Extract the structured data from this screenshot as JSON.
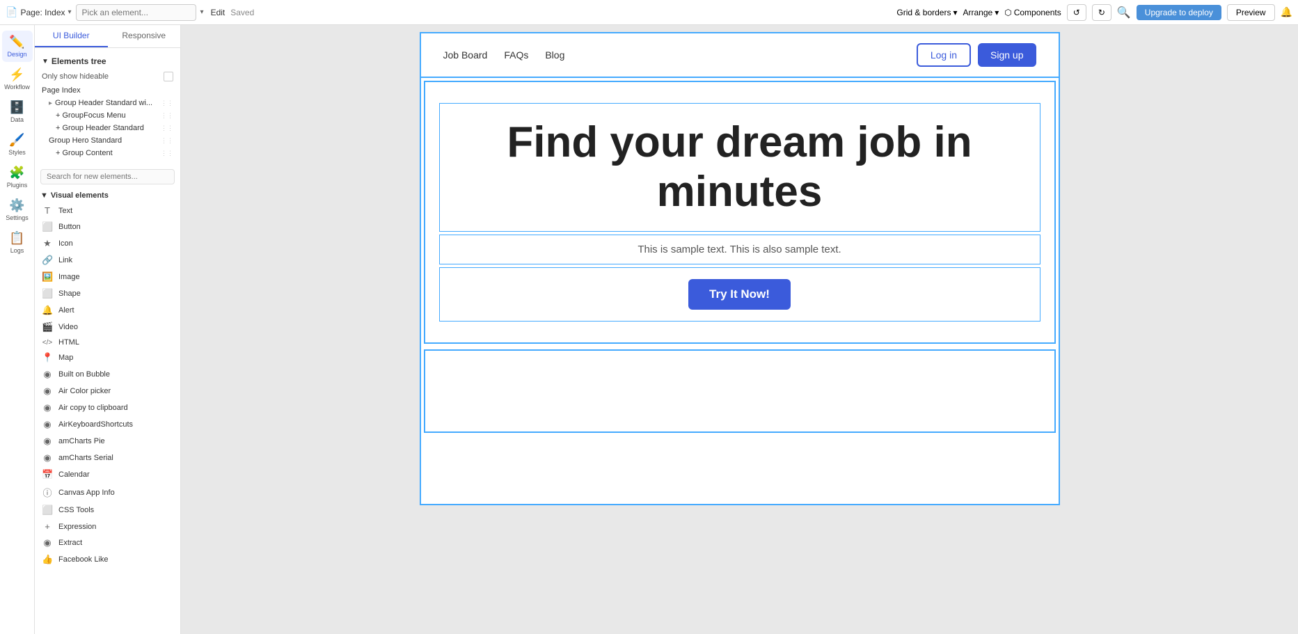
{
  "topbar": {
    "page_icon": "📄",
    "page_label": "Page: Index",
    "pick_placeholder": "Pick an element...",
    "edit_label": "Edit",
    "saved_label": "Saved",
    "grid_borders": "Grid & borders",
    "arrange": "Arrange",
    "components": "Components",
    "upgrade_label": "Upgrade to deploy",
    "preview_label": "Preview"
  },
  "left_sidebar": {
    "items": [
      {
        "id": "design",
        "icon": "✏️",
        "label": "Design"
      },
      {
        "id": "workflow",
        "icon": "⚡",
        "label": "Workflow"
      },
      {
        "id": "data",
        "icon": "🗄️",
        "label": "Data"
      },
      {
        "id": "styles",
        "icon": "🖌️",
        "label": "Styles"
      },
      {
        "id": "plugins",
        "icon": "🧩",
        "label": "Plugins"
      },
      {
        "id": "settings",
        "icon": "⚙️",
        "label": "Settings"
      },
      {
        "id": "logs",
        "icon": "📋",
        "label": "Logs"
      }
    ]
  },
  "left_panel": {
    "tabs": [
      {
        "id": "ui-builder",
        "label": "UI Builder"
      },
      {
        "id": "responsive",
        "label": "Responsive"
      }
    ],
    "active_tab": "ui-builder",
    "elements_tree_label": "Elements tree",
    "only_hideable_label": "Only show hideable",
    "tree_nodes": [
      {
        "id": "page-index",
        "label": "Page Index",
        "indent": 0,
        "expandable": false
      },
      {
        "id": "group-header-standard-wi",
        "label": "Group Header Standard wi...",
        "indent": 1,
        "expandable": true
      },
      {
        "id": "group-focus-menu",
        "label": "+ GroupFocus Menu",
        "indent": 2,
        "expandable": false
      },
      {
        "id": "group-header-standard",
        "label": "+ Group Header Standard",
        "indent": 2,
        "expandable": false
      },
      {
        "id": "group-hero-standard",
        "label": "Group Hero Standard",
        "indent": 1,
        "expandable": false
      },
      {
        "id": "group-content",
        "label": "+ Group Content",
        "indent": 2,
        "expandable": false
      }
    ],
    "search_placeholder": "Search for new elements...",
    "visual_elements_label": "Visual elements",
    "elements": [
      {
        "id": "text",
        "icon": "T",
        "label": "Text"
      },
      {
        "id": "button",
        "icon": "⬜",
        "label": "Button"
      },
      {
        "id": "icon",
        "icon": "★",
        "label": "Icon"
      },
      {
        "id": "link",
        "icon": "🔗",
        "label": "Link"
      },
      {
        "id": "image",
        "icon": "🖼️",
        "label": "Image"
      },
      {
        "id": "shape",
        "icon": "⬜",
        "label": "Shape"
      },
      {
        "id": "alert",
        "icon": "🔔",
        "label": "Alert"
      },
      {
        "id": "video",
        "icon": "🎬",
        "label": "Video"
      },
      {
        "id": "html",
        "icon": "</>",
        "label": "HTML"
      },
      {
        "id": "map",
        "icon": "📍",
        "label": "Map"
      },
      {
        "id": "built-on-bubble",
        "icon": "◉",
        "label": "Built on Bubble"
      },
      {
        "id": "air-color-picker",
        "icon": "◉",
        "label": "Air Color picker"
      },
      {
        "id": "air-copy-to-clipboard",
        "icon": "◉",
        "label": "Air copy to clipboard"
      },
      {
        "id": "air-keyboard-shortcuts",
        "icon": "◉",
        "label": "AirKeyboardShortcuts"
      },
      {
        "id": "am-charts-pie",
        "icon": "◉",
        "label": "amCharts Pie"
      },
      {
        "id": "am-charts-serial",
        "icon": "◉",
        "label": "amCharts Serial"
      },
      {
        "id": "calendar",
        "icon": "📅",
        "label": "Calendar"
      },
      {
        "id": "canvas-app-info",
        "icon": "ⓘ",
        "label": "Canvas App Info"
      },
      {
        "id": "css-tools",
        "icon": "⬜",
        "label": "CSS Tools"
      },
      {
        "id": "expression",
        "icon": "+",
        "label": "Expression"
      },
      {
        "id": "extract",
        "icon": "◉",
        "label": "Extract"
      },
      {
        "id": "facebook-like",
        "icon": "👍",
        "label": "Facebook Like"
      }
    ]
  },
  "preview": {
    "nav_links": [
      {
        "id": "job-board",
        "label": "Job Board"
      },
      {
        "id": "faqs",
        "label": "FAQs"
      },
      {
        "id": "blog",
        "label": "Blog"
      }
    ],
    "login_label": "Log in",
    "signup_label": "Sign up",
    "hero_title": "Find your dream job in minutes",
    "hero_subtitle": "This is sample text. This is also sample text.",
    "cta_label": "Try It Now!"
  }
}
